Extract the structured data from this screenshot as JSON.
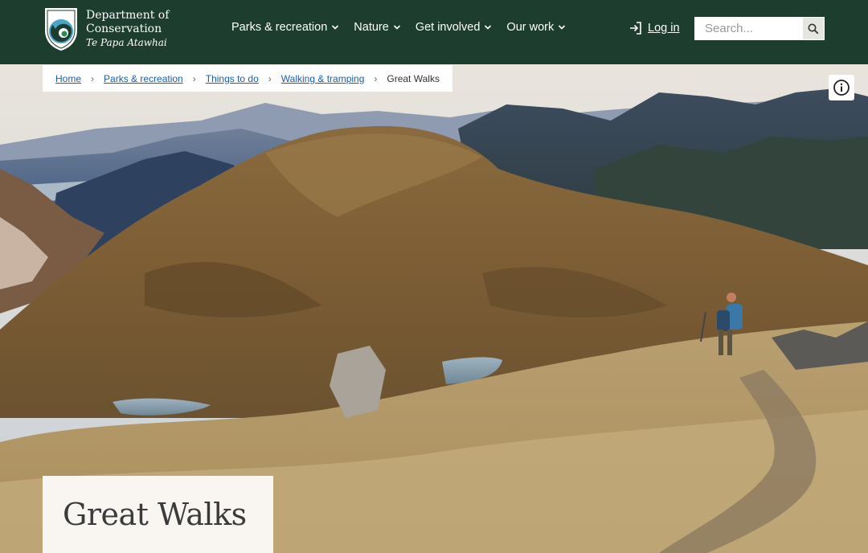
{
  "header": {
    "logo": {
      "line1": "Department of",
      "line2": "Conservation",
      "line3": "Te Papa Atawhai"
    },
    "nav": [
      {
        "label": "Parks & recreation"
      },
      {
        "label": "Nature"
      },
      {
        "label": "Get involved"
      },
      {
        "label": "Our work"
      }
    ],
    "login_label": "Log in",
    "search_placeholder": "Search..."
  },
  "breadcrumb": {
    "items": [
      "Home",
      "Parks & recreation",
      "Things to do",
      "Walking & tramping"
    ],
    "current": "Great Walks"
  },
  "hero": {
    "title": "Great Walks"
  },
  "colors": {
    "header_bg": "#1d3d2f",
    "link": "#1a5fb4"
  }
}
